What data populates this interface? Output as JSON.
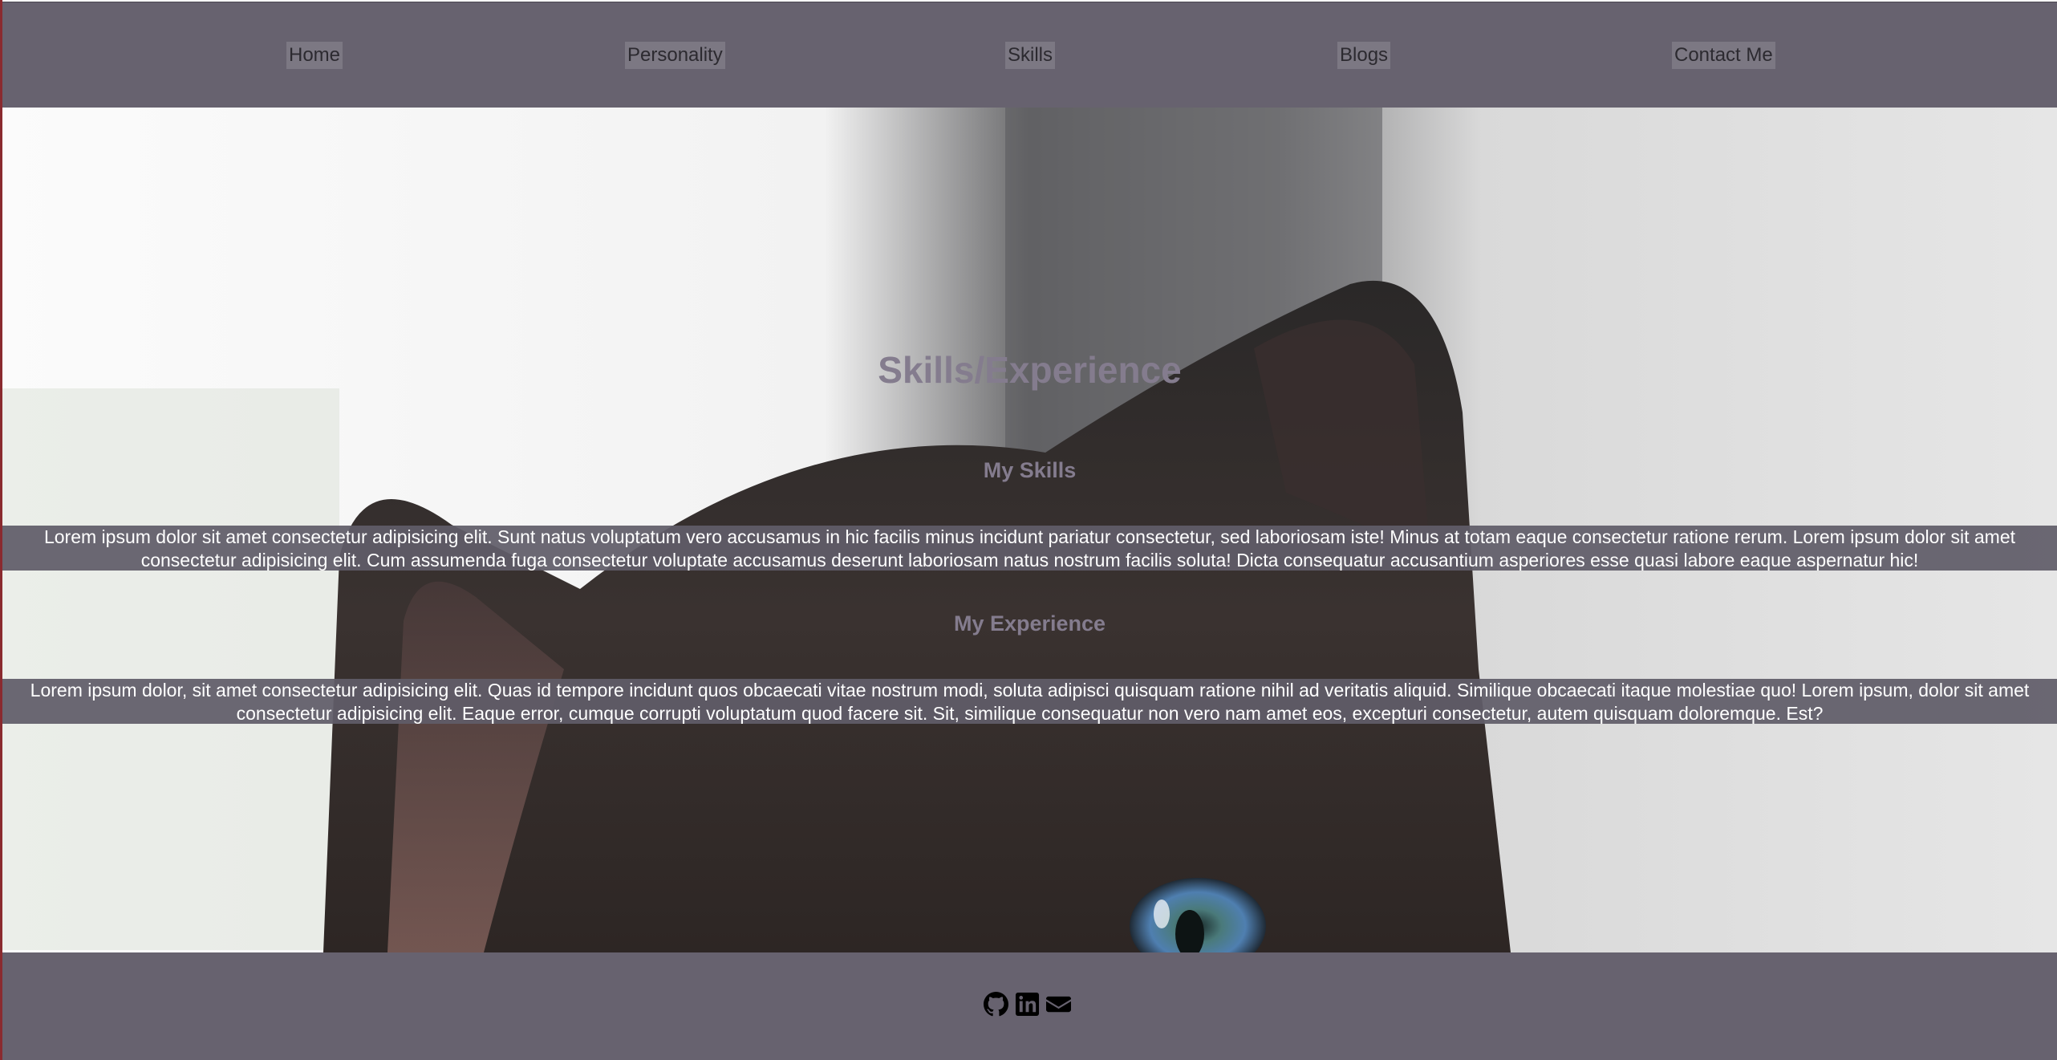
{
  "nav": {
    "items": [
      {
        "label": "Home"
      },
      {
        "label": "Personality"
      },
      {
        "label": "Skills"
      },
      {
        "label": "Blogs"
      },
      {
        "label": "Contact Me"
      }
    ]
  },
  "hero": {
    "title": "Skills/Experience",
    "skills_heading": "My Skills",
    "skills_text": "Lorem ipsum dolor sit amet consectetur adipisicing elit. Sunt natus voluptatum vero accusamus in hic facilis minus incidunt pariatur consectetur, sed laboriosam iste! Minus at totam eaque consectetur ratione rerum. Lorem ipsum dolor sit amet consectetur adipisicing elit. Cum assumenda fuga consectetur voluptate accusamus deserunt laboriosam natus nostrum facilis soluta! Dicta consequatur accusantium asperiores esse quasi labore eaque aspernatur hic!",
    "experience_heading": "My Experience",
    "experience_text": "Lorem ipsum dolor, sit amet consectetur adipisicing elit. Quas id tempore incidunt quos obcaecati vitae nostrum modi, soluta adipisci quisquam ratione nihil ad veritatis aliquid. Similique obcaecati itaque molestiae quo! Lorem ipsum, dolor sit amet consectetur adipisicing elit. Eaque error, cumque corrupti voluptatum quod facere sit. Sit, similique consequatur non vero nam amet eos, excepturi consectetur, autem quisquam doloremque. Est?"
  },
  "footer": {
    "social": [
      {
        "icon": "github-icon"
      },
      {
        "icon": "linkedin-icon"
      },
      {
        "icon": "envelope-icon"
      }
    ]
  },
  "colors": {
    "bar_bg": "#67626f",
    "nav_item_bg": "#7c7883",
    "heading": "#847c8e",
    "band_bg": "#605c68"
  }
}
